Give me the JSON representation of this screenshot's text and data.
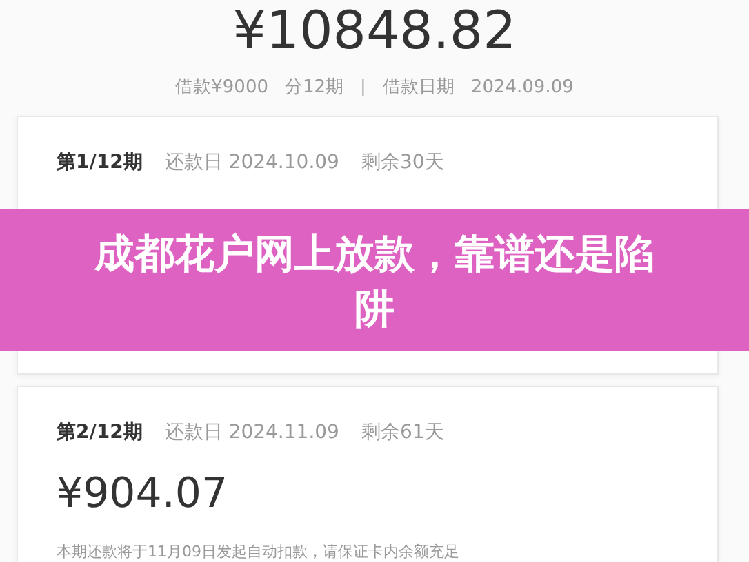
{
  "summary": {
    "total": "¥10848.82",
    "loan": "借款¥9000",
    "periods": "分12期",
    "separator": "|",
    "date_label": "借款日期",
    "date": "2024.09.09"
  },
  "installments": [
    {
      "period": "第1/12期",
      "due_label": "还款日 2024.10.09",
      "remaining": "剩余30天"
    },
    {
      "period": "第2/12期",
      "due_label": "还款日 2024.11.09",
      "remaining": "剩余61天",
      "amount": "¥904.07",
      "note": "本期还款将于11月09日发起自动扣款，请保证卡内余额充足"
    }
  ],
  "banner": {
    "title": "成都花户网上放款，靠谱还是陷阱"
  }
}
